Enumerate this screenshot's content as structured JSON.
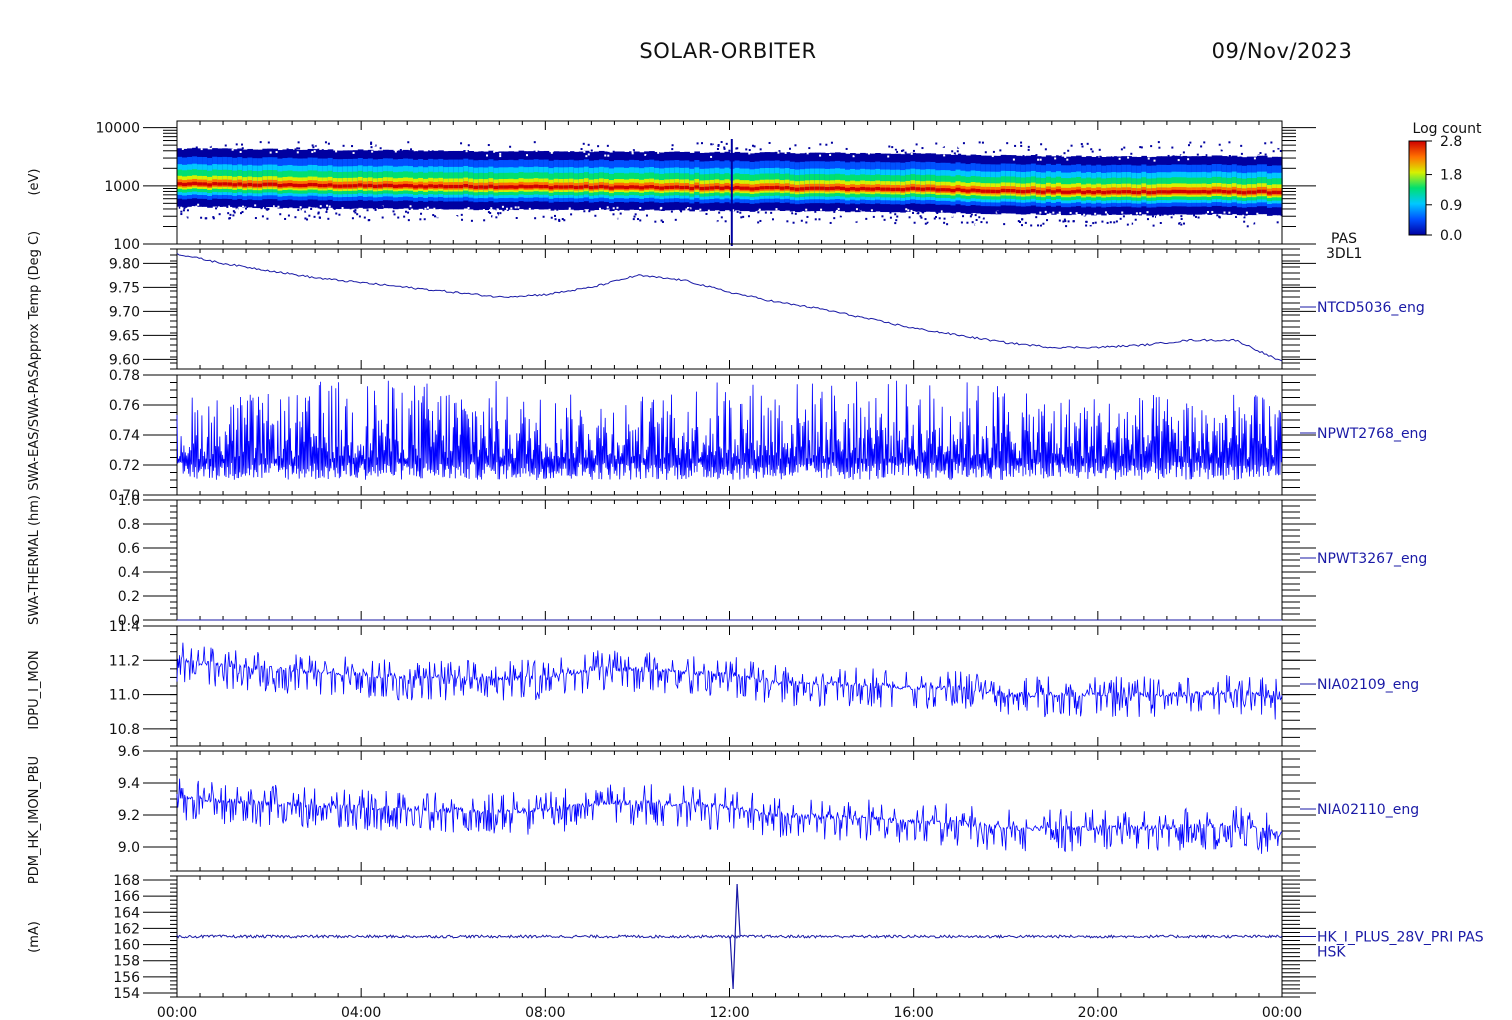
{
  "header": {
    "mission": "SOLAR-ORBITER",
    "date": "09/Nov/2023"
  },
  "chart_data": [
    {
      "type": "heatmap",
      "panel": "spectrogram",
      "labels": [
        "PAS",
        "3DL1"
      ],
      "ylabel": "(eV)",
      "yscale": "log",
      "ylim": [
        100,
        13000
      ],
      "yticks": [
        "10000",
        "1000",
        "100"
      ],
      "x": [
        "00:00",
        "04:00",
        "08:00",
        "12:00",
        "16:00",
        "20:00",
        "00:00"
      ],
      "peak_energy_ev": [
        [
          0,
          1050
        ],
        [
          2,
          1020
        ],
        [
          4,
          980
        ],
        [
          6,
          960
        ],
        [
          8,
          940
        ],
        [
          10,
          920
        ],
        [
          12,
          900
        ],
        [
          14,
          880
        ],
        [
          16,
          860
        ],
        [
          18,
          800
        ],
        [
          20,
          760
        ],
        [
          22,
          780
        ],
        [
          24,
          760
        ]
      ],
      "colorbar": {
        "title": "Log count",
        "ticks": [
          "2.8",
          "1.8",
          "0.9",
          "0.0"
        ],
        "range": [
          0.0,
          2.8
        ]
      },
      "colors": [
        "#0000a0",
        "#0050ff",
        "#00c8ff",
        "#00e070",
        "#d8f000",
        "#ff7000",
        "#d00000"
      ]
    },
    {
      "type": "line",
      "label": "NTCD5036_eng",
      "ylabel": "Approx Temp (Deg C)",
      "ylim": [
        9.58,
        9.83
      ],
      "yticks": [
        "9.80",
        "9.75",
        "9.70",
        "9.65",
        "9.60"
      ],
      "x": [
        0,
        1,
        2,
        3,
        4,
        5,
        6,
        7,
        8,
        9,
        10,
        11,
        12,
        13,
        14,
        15,
        16,
        17,
        18,
        19,
        20,
        21,
        22,
        23,
        24
      ],
      "y": [
        9.82,
        9.8,
        9.785,
        9.77,
        9.76,
        9.75,
        9.74,
        9.73,
        9.735,
        9.75,
        9.775,
        9.765,
        9.74,
        9.72,
        9.705,
        9.685,
        9.665,
        9.65,
        9.635,
        9.625,
        9.625,
        9.63,
        9.64,
        9.64,
        9.595
      ],
      "color": "#1a1aa6"
    },
    {
      "type": "line",
      "label": "NPWT2768_eng",
      "ylabel": "SWA-EAS/SWA-PAS",
      "ylim": [
        0.7,
        0.78
      ],
      "yticks": [
        "0.78",
        "0.76",
        "0.74",
        "0.72",
        "0.70"
      ],
      "baseline": 0.724,
      "noise_low": 0.71,
      "noise_high": 0.77,
      "x": [
        0,
        24
      ],
      "color": "#0000ff"
    },
    {
      "type": "line",
      "label": "NPWT3267_eng",
      "ylabel": "SWA-THERMAL (hm)",
      "ylim": [
        0.0,
        1.0
      ],
      "yticks": [
        "1.0",
        "0.8",
        "0.6",
        "0.4",
        "0.2",
        "0.0"
      ],
      "x": [
        0,
        24
      ],
      "y": [
        0.0,
        0.0
      ],
      "color": "#1a1aa6"
    },
    {
      "type": "line",
      "label": "NIA02109_eng",
      "ylabel": "IDPU_I_MON",
      "ylim": [
        10.7,
        11.4
      ],
      "yticks": [
        "11.4",
        "11.2",
        "11.0",
        "10.8"
      ],
      "x": [
        0,
        1,
        2,
        3,
        4,
        5,
        6,
        7,
        8,
        9,
        10,
        11,
        12,
        13,
        14,
        15,
        16,
        17,
        18,
        19,
        20,
        21,
        22,
        23,
        24
      ],
      "y": [
        11.2,
        11.17,
        11.15,
        11.13,
        11.12,
        11.1,
        11.1,
        11.09,
        11.1,
        11.15,
        11.15,
        11.13,
        11.12,
        11.07,
        11.06,
        11.06,
        11.04,
        11.04,
        11.0,
        11.0,
        11.0,
        11.0,
        11.0,
        11.02,
        10.98
      ],
      "color": "#0000ff"
    },
    {
      "type": "line",
      "label": "NIA02110_eng",
      "ylabel": "PDM_HK_IMON_PBU",
      "ylim": [
        8.85,
        9.6
      ],
      "yticks": [
        "9.6",
        "9.4",
        "9.2",
        "9.0"
      ],
      "x": [
        0,
        1,
        2,
        3,
        4,
        5,
        6,
        7,
        8,
        9,
        10,
        11,
        12,
        13,
        14,
        15,
        16,
        17,
        18,
        19,
        20,
        21,
        22,
        23,
        24
      ],
      "y": [
        9.32,
        9.29,
        9.27,
        9.26,
        9.25,
        9.24,
        9.23,
        9.22,
        9.23,
        9.27,
        9.28,
        9.27,
        9.25,
        9.2,
        9.19,
        9.18,
        9.16,
        9.15,
        9.12,
        9.12,
        9.12,
        9.12,
        9.13,
        9.14,
        9.08
      ],
      "color": "#0000ff"
    },
    {
      "type": "line",
      "label": "HK_I_PLUS_28V_PRI PAS",
      "label2": "HSK",
      "ylabel": "(mA)",
      "ylim": [
        153.5,
        168.5
      ],
      "yticks": [
        "168",
        "166",
        "164",
        "162",
        "160",
        "158",
        "156",
        "154"
      ],
      "baseline": 161.0,
      "spike": {
        "x": 12.1,
        "low": 154.5,
        "high": 167.5
      },
      "x": [
        0,
        24
      ],
      "color": "#1a1aa6"
    }
  ],
  "xaxis": {
    "ticks": [
      "00:00",
      "04:00",
      "08:00",
      "12:00",
      "16:00",
      "20:00",
      "00:00"
    ]
  }
}
